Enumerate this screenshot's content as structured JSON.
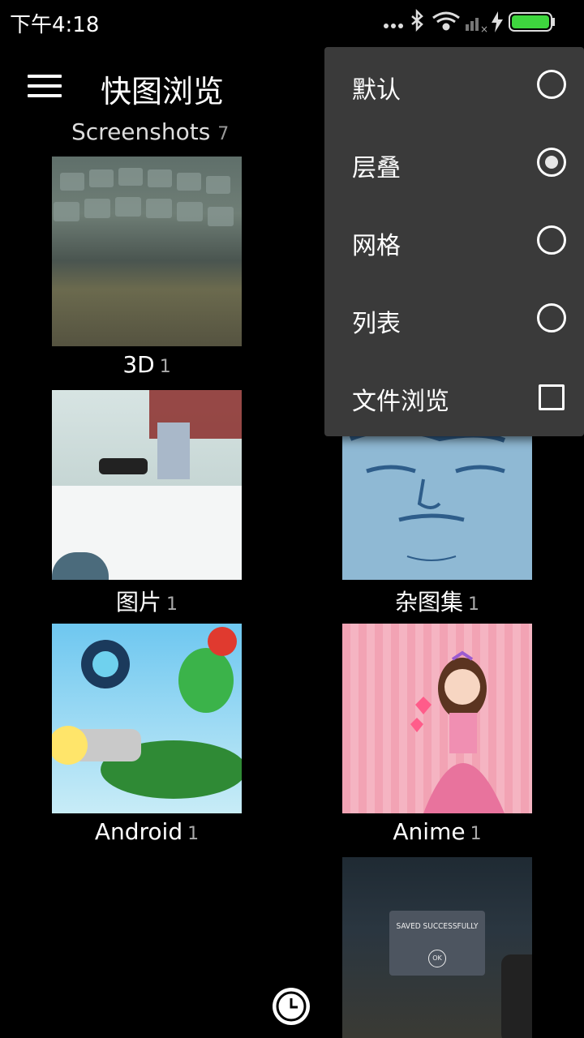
{
  "status_bar": {
    "time": "下午4:18",
    "icons": [
      "more-dots-icon",
      "bluetooth-icon",
      "wifi-icon",
      "signal-icon",
      "charging-icon",
      "battery-icon"
    ],
    "battery_color": "#3ed63e"
  },
  "app_bar": {
    "title": "快图浏览",
    "menu_icon": "hamburger-menu-icon"
  },
  "section": {
    "title": "Screenshots",
    "count": "7"
  },
  "albums": [
    {
      "name": "3D",
      "count": "1"
    },
    {
      "name": "图片",
      "count": "1"
    },
    {
      "name": "杂图集",
      "count": "1"
    },
    {
      "name": "Android",
      "count": "1"
    },
    {
      "name": "Anime",
      "count": "1"
    }
  ],
  "saved_dialog": {
    "text": "SAVED SUCCESSFULLY",
    "ok": "OK"
  },
  "popup_menu": {
    "items": [
      {
        "label": "默认",
        "type": "radio",
        "selected": false
      },
      {
        "label": "层叠",
        "type": "radio",
        "selected": true
      },
      {
        "label": "网格",
        "type": "radio",
        "selected": false
      },
      {
        "label": "列表",
        "type": "radio",
        "selected": false
      },
      {
        "label": "文件浏览",
        "type": "checkbox",
        "selected": false
      }
    ]
  },
  "colors": {
    "background": "#000000",
    "popup_bg": "#3a3a3a",
    "text": "#ffffff"
  }
}
